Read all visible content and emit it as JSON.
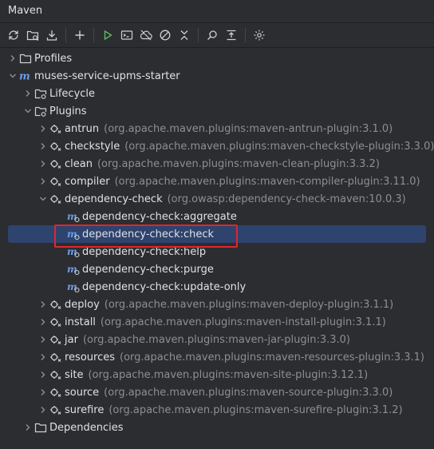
{
  "title": "Maven",
  "toolbar": [
    {
      "name": "reload-icon"
    },
    {
      "name": "generate-sources-icon"
    },
    {
      "name": "download-icon"
    },
    {
      "name": "add-icon"
    },
    {
      "name": "run-icon"
    },
    {
      "name": "execute-goal-icon"
    },
    {
      "name": "offline-icon"
    },
    {
      "name": "skip-tests-icon"
    },
    {
      "name": "collapse-icon"
    },
    {
      "name": "analyze-icon"
    },
    {
      "name": "expand-all-icon"
    },
    {
      "name": "settings-icon"
    }
  ],
  "tree": {
    "profiles": "Profiles",
    "project": "muses-service-upms-starter",
    "lifecycle": "Lifecycle",
    "plugins": "Plugins",
    "plugin_list": [
      {
        "name": "antrun",
        "coord": "(org.apache.maven.plugins:maven-antrun-plugin:3.1.0)"
      },
      {
        "name": "checkstyle",
        "coord": "(org.apache.maven.plugins:maven-checkstyle-plugin:3.3.0)"
      },
      {
        "name": "clean",
        "coord": "(org.apache.maven.plugins:maven-clean-plugin:3.3.2)"
      },
      {
        "name": "compiler",
        "coord": "(org.apache.maven.plugins:maven-compiler-plugin:3.11.0)"
      },
      {
        "name": "dependency-check",
        "coord": "(org.owasp:dependency-check-maven:10.0.3)"
      },
      {
        "name": "deploy",
        "coord": "(org.apache.maven.plugins:maven-deploy-plugin:3.1.1)"
      },
      {
        "name": "install",
        "coord": "(org.apache.maven.plugins:maven-install-plugin:3.1.1)"
      },
      {
        "name": "jar",
        "coord": "(org.apache.maven.plugins:maven-jar-plugin:3.3.0)"
      },
      {
        "name": "resources",
        "coord": "(org.apache.maven.plugins:maven-resources-plugin:3.3.1)"
      },
      {
        "name": "site",
        "coord": "(org.apache.maven.plugins:maven-site-plugin:3.12.1)"
      },
      {
        "name": "source",
        "coord": "(org.apache.maven.plugins:maven-source-plugin:3.3.0)"
      },
      {
        "name": "surefire",
        "coord": "(org.apache.maven.plugins:maven-surefire-plugin:3.1.2)"
      }
    ],
    "goals": [
      "dependency-check:aggregate",
      "dependency-check:check",
      "dependency-check:help",
      "dependency-check:purge",
      "dependency-check:update-only"
    ],
    "dependencies": "Dependencies"
  },
  "colors": {
    "accent": "#2e436e",
    "highlight": "#e0262b",
    "text": "#dfe1e5",
    "muted": "#8c8f94"
  }
}
